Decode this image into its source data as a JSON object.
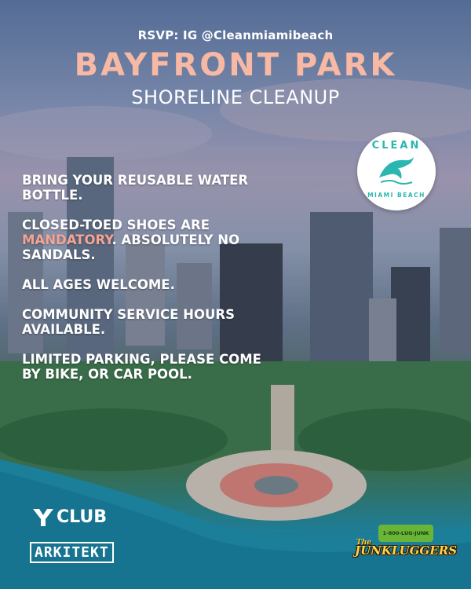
{
  "event": {
    "rsvp": "RSVP: IG @Cleanmiamibeach",
    "title": "BAYFRONT PARK",
    "subtitle": "SHORELINE CLEANUP"
  },
  "logo_clean": {
    "top_word": "CLEAN",
    "bottom_word": "MIAMI BEACH",
    "icon": "dolphin-icon"
  },
  "rules": [
    {
      "text": "BRING YOUR REUSABLE WATER BOTTLE."
    },
    {
      "pre": "CLOSED-TOED SHOES ARE ",
      "highlight": "MANDATORY",
      "post": ". ABSOLUTELY NO SANDALS."
    },
    {
      "text": "ALL AGES WELCOME."
    },
    {
      "text": "COMMUNITY SERVICE HOURS AVAILABLE."
    },
    {
      "text": "LIMITED PARKING, PLEASE COME BY BIKE, OR CAR POOL."
    }
  ],
  "sponsors": {
    "yclub": "CLUB",
    "arkitekt": "ARKITEKT",
    "junkluggers": {
      "the": "The",
      "name": "JUNKLUGGERS",
      "truck_phone": "1-800-LUG-JUNK"
    }
  },
  "colors": {
    "title": "#f7b8a4",
    "highlight": "#f4a493",
    "logo_teal": "#2bb6b0"
  }
}
